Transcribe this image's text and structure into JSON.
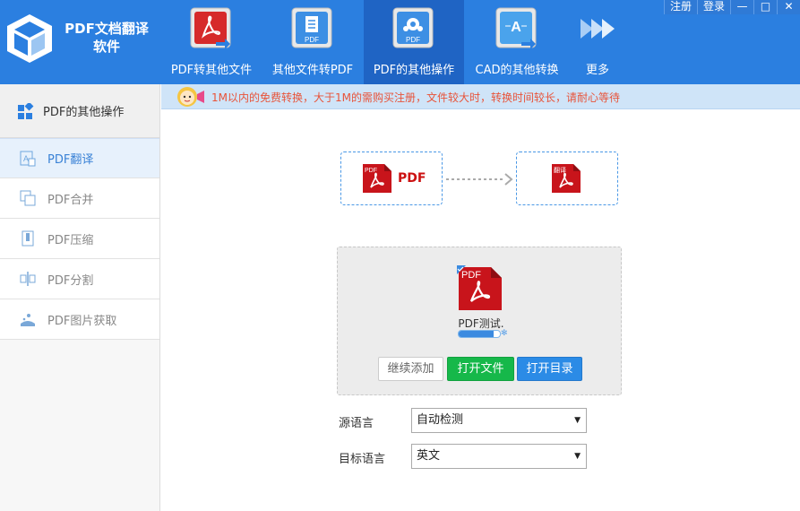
{
  "app": {
    "title_line1": "PDF文档翻译",
    "title_line2": "软件"
  },
  "top_links": {
    "register": "注册",
    "login": "登录"
  },
  "nav": [
    {
      "label": "PDF转其他文件",
      "icon": "pdf-convert-icon"
    },
    {
      "label": "其他文件转PDF",
      "icon": "file-to-pdf-icon"
    },
    {
      "label": "PDF的其他操作",
      "icon": "pdf-gear-icon",
      "active": true
    },
    {
      "label": "CAD的其他转换",
      "icon": "cad-convert-icon"
    },
    {
      "label": "更多",
      "icon": "more-arrows-icon"
    }
  ],
  "sidebar": {
    "header": "PDF的其他操作",
    "items": [
      {
        "label": "PDF翻译",
        "icon": "translate-icon",
        "active": true
      },
      {
        "label": "PDF合并",
        "icon": "merge-icon"
      },
      {
        "label": "PDF压缩",
        "icon": "compress-icon"
      },
      {
        "label": "PDF分割",
        "icon": "split-icon"
      },
      {
        "label": "PDF图片获取",
        "icon": "image-extract-icon"
      }
    ]
  },
  "notice": {
    "text": "1M以内的免费转换，大于1M的需购买注册，文件较大时，转换时间较长，请耐心等待"
  },
  "diagram": {
    "source_label": "PDF",
    "source_icon_text": "PDF",
    "target_icon_text": "翻译"
  },
  "file": {
    "icon_text": "PDF",
    "name": "PDF测试.",
    "progress": 0.85
  },
  "buttons": {
    "add": "继续添加",
    "open_file": "打开文件",
    "open_dir": "打开目录"
  },
  "languages": {
    "source_label": "源语言",
    "source_value": "自动检测",
    "target_label": "目标语言",
    "target_value": "英文"
  },
  "colors": {
    "header_bg": "#2b7fe0",
    "active_nav": "#1f64c4",
    "pdf_red": "#c8141b",
    "green_button": "#16b84a",
    "blue_button": "#2b8be6",
    "notice_text": "#e8543a"
  }
}
